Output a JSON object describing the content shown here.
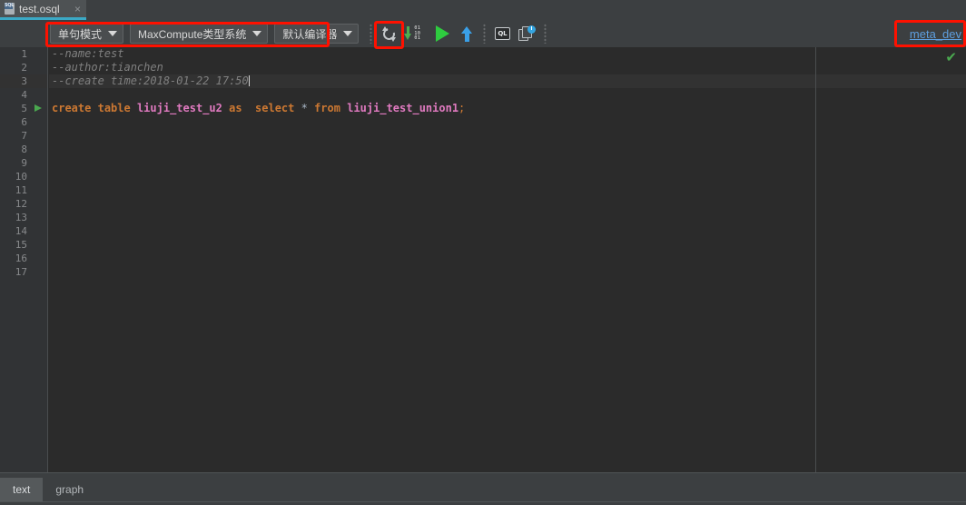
{
  "tabbar": {
    "tabs": [
      {
        "label": "test.osql",
        "icon": "sql-file-icon",
        "badge": "SQL",
        "close": "×",
        "active": true
      }
    ]
  },
  "toolbar": {
    "combos": [
      {
        "name": "statement-mode",
        "label": "单句模式"
      },
      {
        "name": "type-system",
        "label": "MaxCompute类型系统"
      },
      {
        "name": "compiler",
        "label": "默认编译器"
      }
    ],
    "icons": [
      {
        "name": "sync-icon",
        "title": "sync"
      },
      {
        "name": "download-icon",
        "title": "download",
        "bits_top": "01",
        "bits_mid": "10",
        "bits_bot": "01"
      },
      {
        "name": "run-icon",
        "title": "run"
      },
      {
        "name": "upload-icon",
        "title": "upload"
      },
      {
        "name": "ql-icon",
        "title": "QL",
        "text": "QL"
      },
      {
        "name": "history-icon",
        "title": "history"
      }
    ],
    "meta_link": "meta_dev"
  },
  "editor": {
    "line_count": 17,
    "current_line": 3,
    "run_marker_line": 5,
    "status_check": "✔",
    "lines": [
      {
        "n": 1,
        "type": "comment",
        "text": "--name:test"
      },
      {
        "n": 2,
        "type": "comment",
        "text": "--author:tianchen"
      },
      {
        "n": 3,
        "type": "comment",
        "text": "--create time:2018-01-22 17:50"
      },
      {
        "n": 4,
        "type": "blank",
        "text": ""
      },
      {
        "n": 5,
        "type": "sql",
        "text": "create table liuji_test_u2 as  select * from liuji_test_union1;"
      },
      {
        "n": 6,
        "type": "blank",
        "text": ""
      },
      {
        "n": 7,
        "type": "blank",
        "text": ""
      },
      {
        "n": 8,
        "type": "blank",
        "text": ""
      },
      {
        "n": 9,
        "type": "blank",
        "text": ""
      },
      {
        "n": 10,
        "type": "blank",
        "text": ""
      },
      {
        "n": 11,
        "type": "blank",
        "text": ""
      },
      {
        "n": 12,
        "type": "blank",
        "text": ""
      },
      {
        "n": 13,
        "type": "blank",
        "text": ""
      },
      {
        "n": 14,
        "type": "blank",
        "text": ""
      },
      {
        "n": 15,
        "type": "blank",
        "text": ""
      },
      {
        "n": 16,
        "type": "blank",
        "text": ""
      },
      {
        "n": 17,
        "type": "blank",
        "text": ""
      }
    ],
    "sql_tokens": [
      {
        "t": "create",
        "c": "kw"
      },
      {
        "t": " ",
        "c": "op"
      },
      {
        "t": "table",
        "c": "kw"
      },
      {
        "t": " ",
        "c": "op"
      },
      {
        "t": "liuji_test_u2",
        "c": "id"
      },
      {
        "t": " ",
        "c": "op"
      },
      {
        "t": "as",
        "c": "kw"
      },
      {
        "t": "  ",
        "c": "op"
      },
      {
        "t": "select",
        "c": "kw"
      },
      {
        "t": " ",
        "c": "op"
      },
      {
        "t": "*",
        "c": "op"
      },
      {
        "t": " ",
        "c": "op"
      },
      {
        "t": "from",
        "c": "kw"
      },
      {
        "t": " ",
        "c": "op"
      },
      {
        "t": "liuji_test_union1",
        "c": "id"
      },
      {
        "t": ";",
        "c": "pn"
      }
    ]
  },
  "bottom": {
    "tabs": [
      {
        "label": "text",
        "active": true
      },
      {
        "label": "graph",
        "active": false
      }
    ]
  },
  "colors": {
    "accent_tab_underline": "#3ba9c6",
    "annotation_red": "#fe1100",
    "run_green": "#2ecc3f",
    "link_blue": "#5e9fe0",
    "editor_bg": "#2b2b2b",
    "chrome_bg": "#3c3f41",
    "keyword_orange": "#cc7832",
    "identifier_pink": "#e07ac0",
    "comment_grey": "#808080"
  }
}
